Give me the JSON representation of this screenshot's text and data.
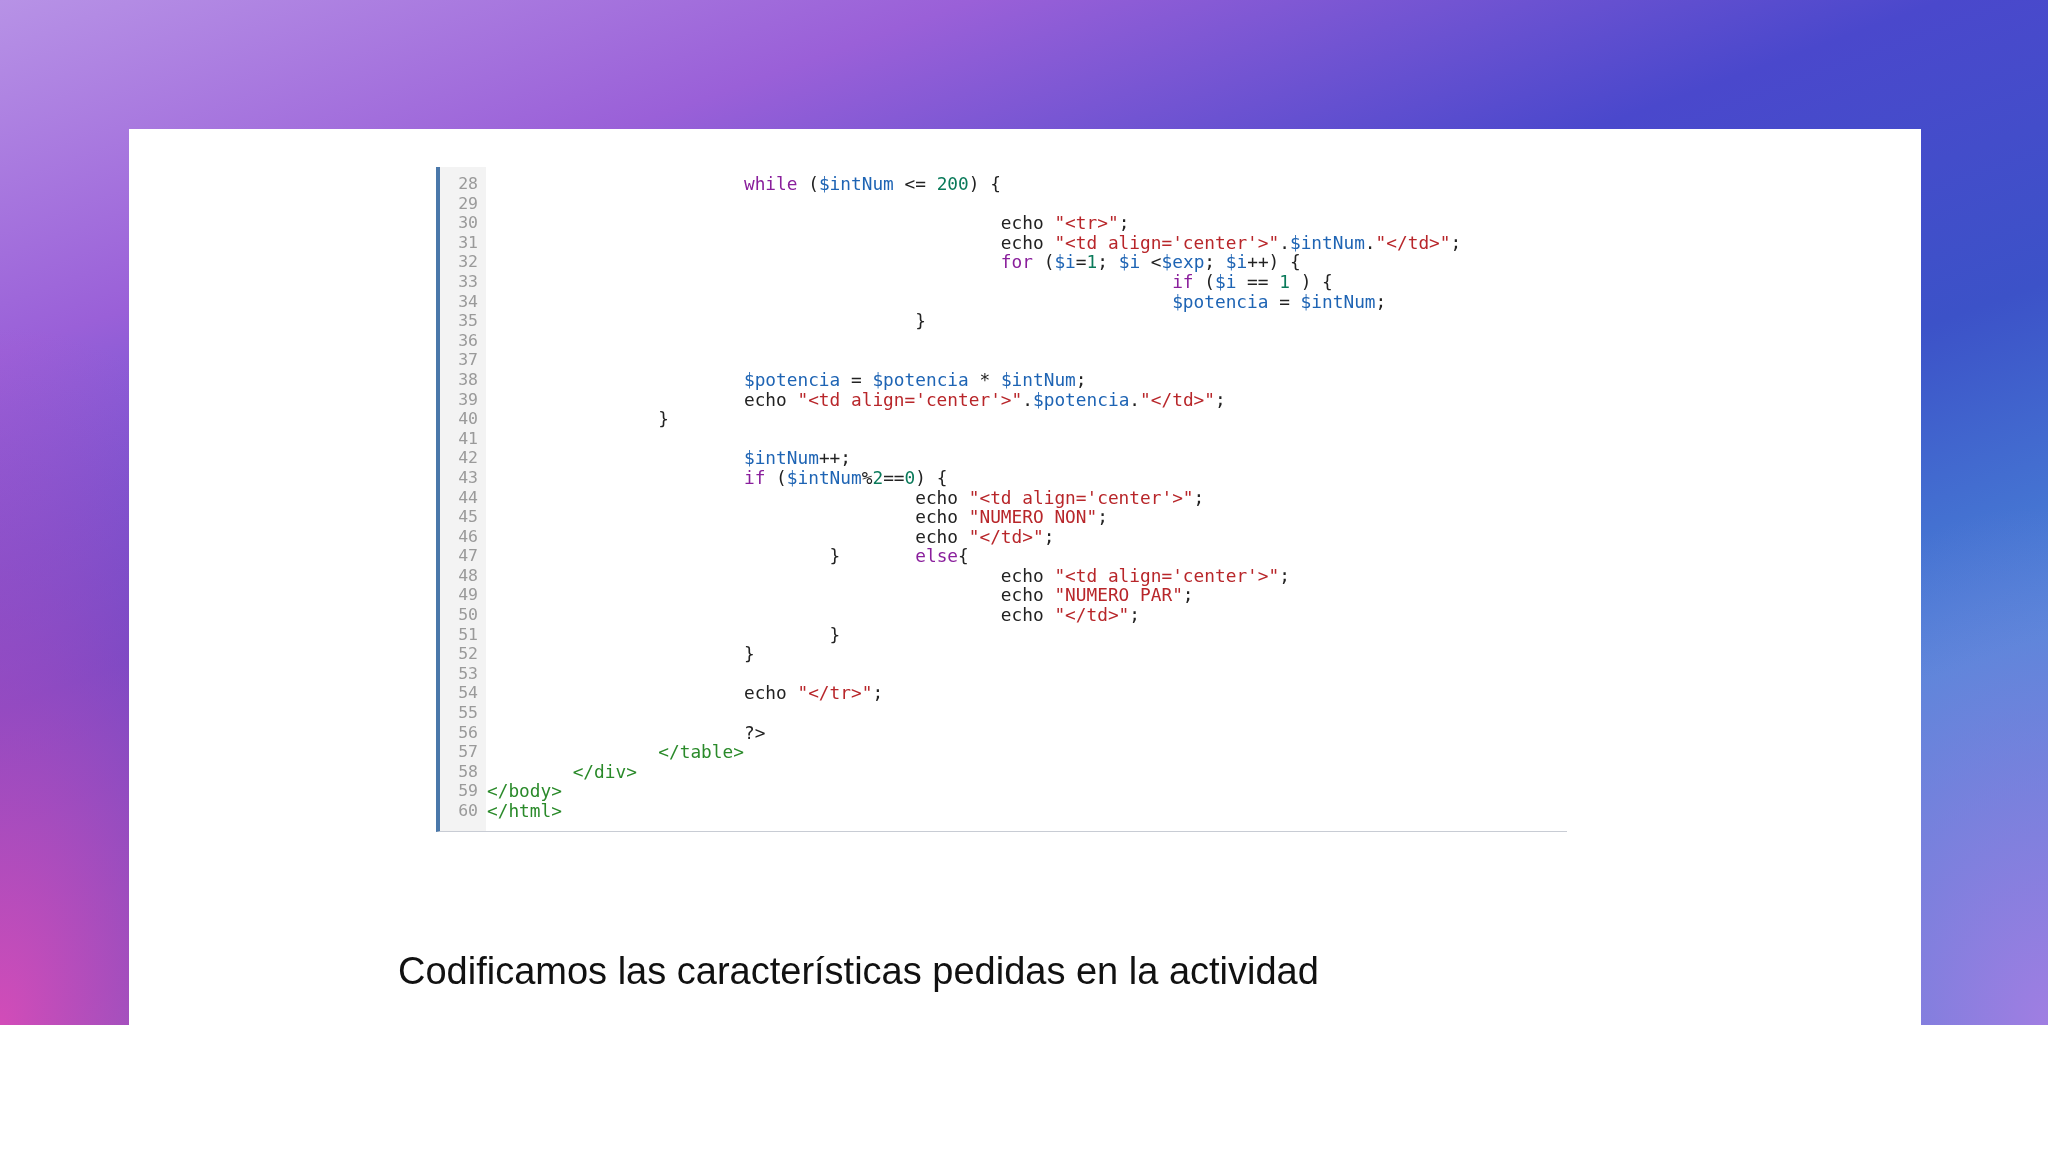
{
  "code_editor": {
    "lines": [
      {
        "number": "28",
        "tokens": [
          {
            "kind": "kw",
            "text": "                        while"
          },
          {
            "kind": "plain",
            "text": " ("
          },
          {
            "kind": "var",
            "text": "$intNum"
          },
          {
            "kind": "plain",
            "text": " <= "
          },
          {
            "kind": "num",
            "text": "200"
          },
          {
            "kind": "plain",
            "text": ") {"
          }
        ]
      },
      {
        "number": "29"
      },
      {
        "number": "30",
        "tokens": [
          {
            "kind": "plain",
            "text": "                                                echo "
          },
          {
            "kind": "str",
            "text": "\"<tr>\""
          },
          {
            "kind": "plain",
            "text": ";"
          }
        ]
      },
      {
        "number": "31",
        "tokens": [
          {
            "kind": "plain",
            "text": "                                                echo "
          },
          {
            "kind": "str",
            "text": "\"<td align='center'>\""
          },
          {
            "kind": "plain",
            "text": "."
          },
          {
            "kind": "var",
            "text": "$intNum"
          },
          {
            "kind": "plain",
            "text": "."
          },
          {
            "kind": "str",
            "text": "\"</td>\""
          },
          {
            "kind": "plain",
            "text": ";"
          }
        ]
      },
      {
        "number": "32",
        "tokens": [
          {
            "kind": "kw",
            "text": "                                                for"
          },
          {
            "kind": "plain",
            "text": " ("
          },
          {
            "kind": "var",
            "text": "$i"
          },
          {
            "kind": "plain",
            "text": "="
          },
          {
            "kind": "num",
            "text": "1"
          },
          {
            "kind": "plain",
            "text": "; "
          },
          {
            "kind": "var",
            "text": "$i"
          },
          {
            "kind": "plain",
            "text": " <"
          },
          {
            "kind": "var",
            "text": "$exp"
          },
          {
            "kind": "plain",
            "text": "; "
          },
          {
            "kind": "var",
            "text": "$i"
          },
          {
            "kind": "plain",
            "text": "++) {"
          }
        ]
      },
      {
        "number": "33",
        "tokens": [
          {
            "kind": "kw",
            "text": "                                                                if"
          },
          {
            "kind": "plain",
            "text": " ("
          },
          {
            "kind": "var",
            "text": "$i"
          },
          {
            "kind": "plain",
            "text": " == "
          },
          {
            "kind": "num",
            "text": "1"
          },
          {
            "kind": "plain",
            "text": " ) {"
          }
        ]
      },
      {
        "number": "34",
        "tokens": [
          {
            "kind": "var",
            "text": "                                                                $potencia"
          },
          {
            "kind": "plain",
            "text": " = "
          },
          {
            "kind": "var",
            "text": "$intNum"
          },
          {
            "kind": "plain",
            "text": ";"
          }
        ]
      },
      {
        "number": "35",
        "tokens": [
          {
            "kind": "plain",
            "text": "                                        }"
          }
        ]
      },
      {
        "number": "36"
      },
      {
        "number": "37"
      },
      {
        "number": "38",
        "tokens": [
          {
            "kind": "var",
            "text": "                        $potencia"
          },
          {
            "kind": "plain",
            "text": " = "
          },
          {
            "kind": "var",
            "text": "$potencia"
          },
          {
            "kind": "plain",
            "text": " * "
          },
          {
            "kind": "var",
            "text": "$intNum"
          },
          {
            "kind": "plain",
            "text": ";"
          }
        ]
      },
      {
        "number": "39",
        "tokens": [
          {
            "kind": "plain",
            "text": "                        echo "
          },
          {
            "kind": "str",
            "text": "\"<td align='center'>\""
          },
          {
            "kind": "plain",
            "text": "."
          },
          {
            "kind": "var",
            "text": "$potencia"
          },
          {
            "kind": "plain",
            "text": "."
          },
          {
            "kind": "str",
            "text": "\"</td>\""
          },
          {
            "kind": "plain",
            "text": ";"
          }
        ]
      },
      {
        "number": "40",
        "tokens": [
          {
            "kind": "plain",
            "text": "                }"
          }
        ]
      },
      {
        "number": "41"
      },
      {
        "number": "42",
        "tokens": [
          {
            "kind": "var",
            "text": "                        $intNum"
          },
          {
            "kind": "plain",
            "text": "++;"
          }
        ]
      },
      {
        "number": "43",
        "tokens": [
          {
            "kind": "kw",
            "text": "                        if"
          },
          {
            "kind": "plain",
            "text": " ("
          },
          {
            "kind": "var",
            "text": "$intNum"
          },
          {
            "kind": "plain",
            "text": "%"
          },
          {
            "kind": "num",
            "text": "2"
          },
          {
            "kind": "plain",
            "text": "=="
          },
          {
            "kind": "num",
            "text": "0"
          },
          {
            "kind": "plain",
            "text": ") {"
          }
        ]
      },
      {
        "number": "44",
        "tokens": [
          {
            "kind": "plain",
            "text": "                                        echo "
          },
          {
            "kind": "str",
            "text": "\"<td align='center'>\""
          },
          {
            "kind": "plain",
            "text": ";"
          }
        ]
      },
      {
        "number": "45",
        "tokens": [
          {
            "kind": "plain",
            "text": "                                        echo "
          },
          {
            "kind": "str",
            "text": "\"NUMERO NON\""
          },
          {
            "kind": "plain",
            "text": ";"
          }
        ]
      },
      {
        "number": "46",
        "tokens": [
          {
            "kind": "plain",
            "text": "                                        echo "
          },
          {
            "kind": "str",
            "text": "\"</td>\""
          },
          {
            "kind": "plain",
            "text": ";"
          }
        ]
      },
      {
        "number": "47",
        "tokens": [
          {
            "kind": "plain",
            "text": "                                }       "
          },
          {
            "kind": "kw",
            "text": "else"
          },
          {
            "kind": "plain",
            "text": "{"
          }
        ]
      },
      {
        "number": "48",
        "tokens": [
          {
            "kind": "plain",
            "text": "                                                echo "
          },
          {
            "kind": "str",
            "text": "\"<td align='center'>\""
          },
          {
            "kind": "plain",
            "text": ";"
          }
        ]
      },
      {
        "number": "49",
        "tokens": [
          {
            "kind": "plain",
            "text": "                                                echo "
          },
          {
            "kind": "str",
            "text": "\"NUMERO PAR\""
          },
          {
            "kind": "plain",
            "text": ";"
          }
        ]
      },
      {
        "number": "50",
        "tokens": [
          {
            "kind": "plain",
            "text": "                                                echo "
          },
          {
            "kind": "str",
            "text": "\"</td>\""
          },
          {
            "kind": "plain",
            "text": ";"
          }
        ]
      },
      {
        "number": "51",
        "tokens": [
          {
            "kind": "plain",
            "text": "                                }"
          }
        ]
      },
      {
        "number": "52",
        "tokens": [
          {
            "kind": "plain",
            "text": "                        }"
          }
        ]
      },
      {
        "number": "53"
      },
      {
        "number": "54",
        "tokens": [
          {
            "kind": "plain",
            "text": "                        echo "
          },
          {
            "kind": "str",
            "text": "\"</tr>\""
          },
          {
            "kind": "plain",
            "text": ";"
          }
        ]
      },
      {
        "number": "55"
      },
      {
        "number": "56",
        "tokens": [
          {
            "kind": "plain",
            "text": "                        ?>"
          }
        ]
      },
      {
        "number": "57",
        "tokens": [
          {
            "kind": "tag",
            "text": "                </table>"
          }
        ]
      },
      {
        "number": "58",
        "tokens": [
          {
            "kind": "tag",
            "text": "        </div>"
          }
        ]
      },
      {
        "number": "59",
        "tokens": [
          {
            "kind": "tag",
            "text": "</body>"
          }
        ]
      },
      {
        "number": "60",
        "tokens": [
          {
            "kind": "tag",
            "text": "</html>"
          }
        ]
      }
    ]
  },
  "caption": "Codificamos las características pedidas en la actividad"
}
